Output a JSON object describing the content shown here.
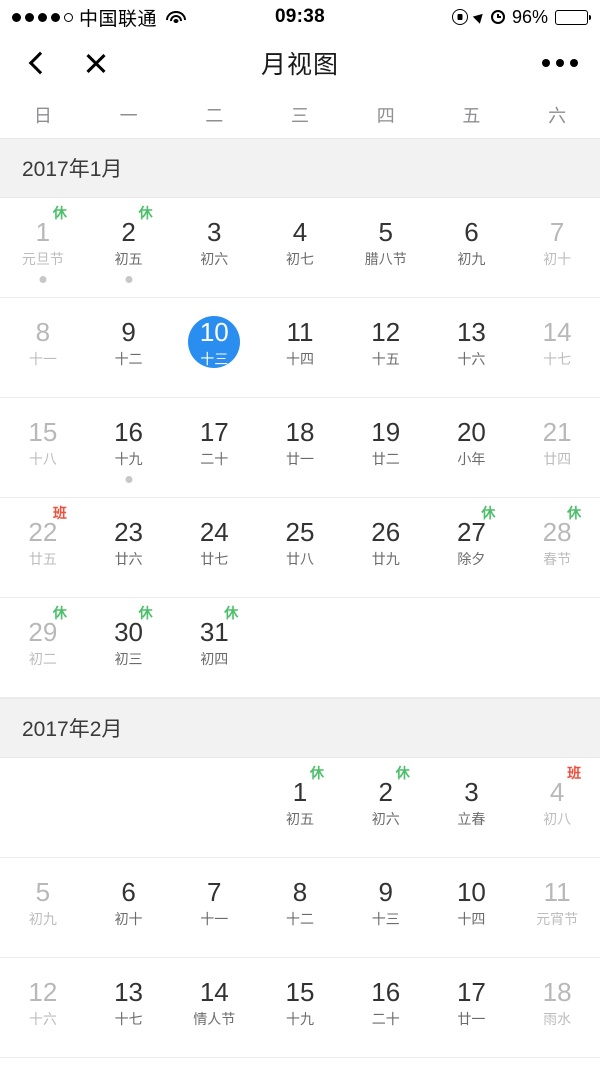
{
  "status_bar": {
    "signal_dots_filled": 4,
    "signal_dots_empty": 1,
    "carrier": "中国联通",
    "wifi_icon": "wifi-icon",
    "time": "09:38",
    "rotation_lock_icon": "rotation-lock-icon",
    "location_icon": "location-arrow-icon",
    "alarm_icon": "alarm-clock-icon",
    "battery_percent": "96%",
    "battery_level": 96
  },
  "nav": {
    "back_icon": "chevron-left-icon",
    "close_icon": "close-icon",
    "title": "月视图",
    "more_icon": "more-horizontal-icon"
  },
  "weekdays": [
    "日",
    "一",
    "二",
    "三",
    "四",
    "五",
    "六"
  ],
  "colors": {
    "selected": "#2a8ef0",
    "rest_badge": "#4cbf6a",
    "work_badge": "#f0503c",
    "month_header_bg": "#f2f2f2",
    "dim_text": "#b8b8b8",
    "event_dot": "#c7c7c7"
  },
  "badge_labels": {
    "rest": "休",
    "work": "班"
  },
  "months": [
    {
      "title": "2017年1月",
      "weeks": [
        [
          {
            "day": "1",
            "lunar": "元旦节",
            "dim": true,
            "badge": "休",
            "badge_type": "rest",
            "dot": true
          },
          {
            "day": "2",
            "lunar": "初五",
            "dim": false,
            "badge": "休",
            "badge_type": "rest",
            "dot": true
          },
          {
            "day": "3",
            "lunar": "初六",
            "dim": false
          },
          {
            "day": "4",
            "lunar": "初七",
            "dim": false
          },
          {
            "day": "5",
            "lunar": "腊八节",
            "dim": false
          },
          {
            "day": "6",
            "lunar": "初九",
            "dim": false
          },
          {
            "day": "7",
            "lunar": "初十",
            "dim": true
          }
        ],
        [
          {
            "day": "8",
            "lunar": "十一",
            "dim": true
          },
          {
            "day": "9",
            "lunar": "十二",
            "dim": false
          },
          {
            "day": "10",
            "lunar": "十三",
            "dim": false,
            "selected": true
          },
          {
            "day": "11",
            "lunar": "十四",
            "dim": false
          },
          {
            "day": "12",
            "lunar": "十五",
            "dim": false
          },
          {
            "day": "13",
            "lunar": "十六",
            "dim": false
          },
          {
            "day": "14",
            "lunar": "十七",
            "dim": true
          }
        ],
        [
          {
            "day": "15",
            "lunar": "十八",
            "dim": true
          },
          {
            "day": "16",
            "lunar": "十九",
            "dim": false,
            "dot": true
          },
          {
            "day": "17",
            "lunar": "二十",
            "dim": false
          },
          {
            "day": "18",
            "lunar": "廿一",
            "dim": false
          },
          {
            "day": "19",
            "lunar": "廿二",
            "dim": false
          },
          {
            "day": "20",
            "lunar": "小年",
            "dim": false
          },
          {
            "day": "21",
            "lunar": "廿四",
            "dim": true
          }
        ],
        [
          {
            "day": "22",
            "lunar": "廿五",
            "dim": true,
            "badge": "班",
            "badge_type": "work"
          },
          {
            "day": "23",
            "lunar": "廿六",
            "dim": false
          },
          {
            "day": "24",
            "lunar": "廿七",
            "dim": false
          },
          {
            "day": "25",
            "lunar": "廿八",
            "dim": false
          },
          {
            "day": "26",
            "lunar": "廿九",
            "dim": false
          },
          {
            "day": "27",
            "lunar": "除夕",
            "dim": false,
            "badge": "休",
            "badge_type": "rest"
          },
          {
            "day": "28",
            "lunar": "春节",
            "dim": true,
            "badge": "休",
            "badge_type": "rest"
          }
        ],
        [
          {
            "day": "29",
            "lunar": "初二",
            "dim": true,
            "badge": "休",
            "badge_type": "rest"
          },
          {
            "day": "30",
            "lunar": "初三",
            "dim": false,
            "badge": "休",
            "badge_type": "rest"
          },
          {
            "day": "31",
            "lunar": "初四",
            "dim": false,
            "badge": "休",
            "badge_type": "rest"
          },
          {
            "empty": true
          },
          {
            "empty": true
          },
          {
            "empty": true
          },
          {
            "empty": true
          }
        ]
      ]
    },
    {
      "title": "2017年2月",
      "weeks": [
        [
          {
            "empty": true
          },
          {
            "empty": true
          },
          {
            "empty": true
          },
          {
            "day": "1",
            "lunar": "初五",
            "dim": false,
            "badge": "休",
            "badge_type": "rest"
          },
          {
            "day": "2",
            "lunar": "初六",
            "dim": false,
            "badge": "休",
            "badge_type": "rest"
          },
          {
            "day": "3",
            "lunar": "立春",
            "dim": false
          },
          {
            "day": "4",
            "lunar": "初八",
            "dim": true,
            "badge": "班",
            "badge_type": "work"
          }
        ],
        [
          {
            "day": "5",
            "lunar": "初九",
            "dim": true
          },
          {
            "day": "6",
            "lunar": "初十",
            "dim": false
          },
          {
            "day": "7",
            "lunar": "十一",
            "dim": false
          },
          {
            "day": "8",
            "lunar": "十二",
            "dim": false
          },
          {
            "day": "9",
            "lunar": "十三",
            "dim": false
          },
          {
            "day": "10",
            "lunar": "十四",
            "dim": false
          },
          {
            "day": "11",
            "lunar": "元宵节",
            "dim": true
          }
        ],
        [
          {
            "day": "12",
            "lunar": "十六",
            "dim": true
          },
          {
            "day": "13",
            "lunar": "十七",
            "dim": false
          },
          {
            "day": "14",
            "lunar": "情人节",
            "dim": false
          },
          {
            "day": "15",
            "lunar": "十九",
            "dim": false
          },
          {
            "day": "16",
            "lunar": "二十",
            "dim": false
          },
          {
            "day": "17",
            "lunar": "廿一",
            "dim": false
          },
          {
            "day": "18",
            "lunar": "雨水",
            "dim": true
          }
        ]
      ]
    }
  ]
}
